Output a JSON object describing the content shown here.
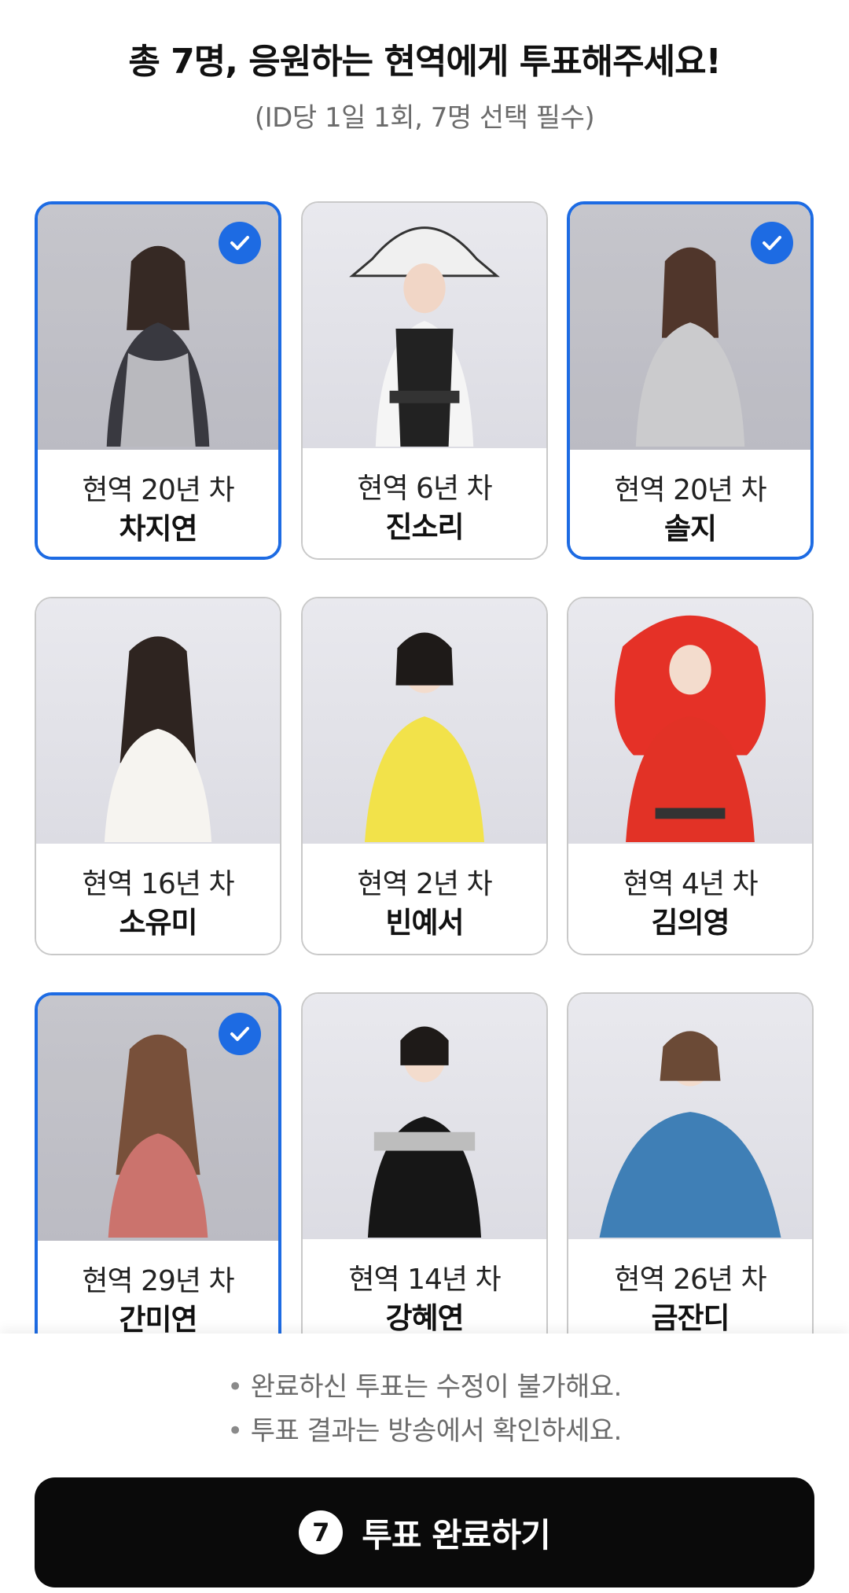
{
  "header": {
    "title": "총 7명, 응원하는 현역에게 투표해주세요!",
    "subtitle": "(ID당 1일 1회, 7명 선택 필수)"
  },
  "candidates": [
    {
      "years": "현역 20년 차",
      "name": "차지연",
      "selected": true
    },
    {
      "years": "현역 6년 차",
      "name": "진소리",
      "selected": false
    },
    {
      "years": "현역 20년 차",
      "name": "솔지",
      "selected": true
    },
    {
      "years": "현역 16년 차",
      "name": "소유미",
      "selected": false
    },
    {
      "years": "현역 2년 차",
      "name": "빈예서",
      "selected": false
    },
    {
      "years": "현역 4년 차",
      "name": "김의영",
      "selected": false
    },
    {
      "years": "현역 29년 차",
      "name": "간미연",
      "selected": true
    },
    {
      "years": "현역 14년 차",
      "name": "강혜연",
      "selected": false
    },
    {
      "years": "현역 26년 차",
      "name": "금잔디",
      "selected": false
    }
  ],
  "notes": [
    "완료하신 투표는 수정이 불가해요.",
    "투표 결과는 방송에서 확인하세요."
  ],
  "submit": {
    "count": "7",
    "label": "투표 완료하기"
  },
  "colors": {
    "accent": "#1d6be3",
    "button_bg": "#0a0a0a",
    "card_border": "#c9c9c9",
    "note_text": "#6b6b6b"
  }
}
